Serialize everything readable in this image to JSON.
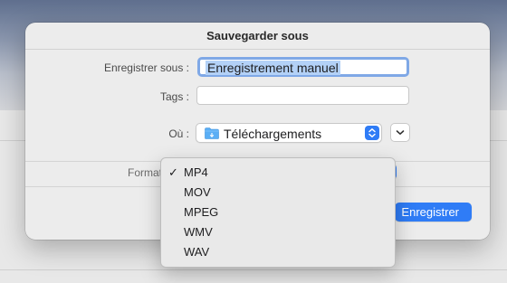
{
  "dialog": {
    "title": "Sauvegarder sous"
  },
  "form": {
    "save_as_label": "Enregistrer sous :",
    "save_as_value": "Enregistrement manuel",
    "tags_label": "Tags :",
    "tags_value": "",
    "where_label": "Où :",
    "where_value": "Téléchargements",
    "where_icon": "folder-icon",
    "format_label": "Format"
  },
  "buttons": {
    "save_label": "Enregistrer"
  },
  "format_menu": {
    "selected": "MP4",
    "options": [
      "MP4",
      "MOV",
      "MPEG",
      "WMV",
      "WAV"
    ]
  },
  "colors": {
    "accent": "#2f7cf6",
    "selection": "#b3d1f7",
    "focus_ring": "#7fa8e6"
  }
}
